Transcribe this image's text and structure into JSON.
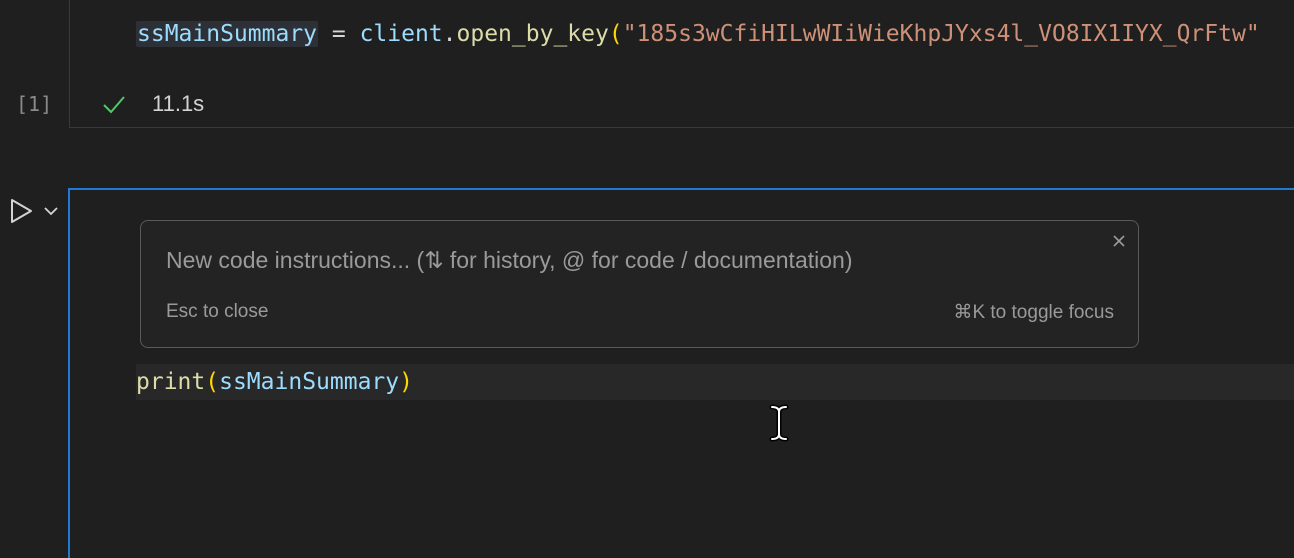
{
  "cell1": {
    "code": {
      "var": "ssMainSummary",
      "op": " = ",
      "obj": "client",
      "dot": ".",
      "fn": "open_by_key",
      "paren": "(",
      "str": "\"185s3wCfiHILwWIiWieKhpJYxs4l_VO8IX1IYX_QrFtw\""
    },
    "execution_count": "[1]",
    "status_icon": "check-icon",
    "duration": "11.1s"
  },
  "cell2": {
    "run_icon": "play-icon",
    "toggle_icon": "chevron-down-icon",
    "prompt": {
      "placeholder": "New code instructions... (⇅ for history, @ for code / documentation)",
      "close_icon": "close-icon",
      "hint_left": "Esc to close",
      "hint_right": "⌘K to toggle focus"
    },
    "code": {
      "fn": "print",
      "paren_open": "(",
      "arg": "ssMainSummary",
      "paren_close": ")"
    }
  },
  "colors": {
    "background": "#1f1f1f",
    "focus_border": "#1f7ad4",
    "variable": "#9cdcfe",
    "function": "#dcdcaa",
    "string": "#ce9178",
    "bracket": "#ffd700",
    "success": "#4ec96a"
  }
}
